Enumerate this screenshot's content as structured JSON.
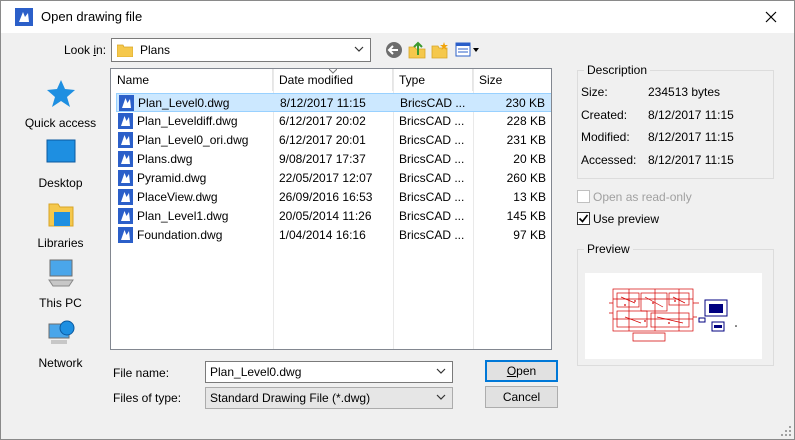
{
  "window": {
    "title": "Open drawing file",
    "close_icon": "close-icon"
  },
  "lookin": {
    "label_pre": "Look ",
    "label_ul": "i",
    "label_post": "n:",
    "value": "Plans",
    "toolbar": [
      "back-arrow-icon",
      "up-folder-icon",
      "new-folder-icon",
      "view-menu-icon"
    ]
  },
  "places": [
    {
      "label": "Quick access",
      "icon": "star-icon"
    },
    {
      "label": "Desktop",
      "icon": "desktop-icon"
    },
    {
      "label": "Libraries",
      "icon": "libraries-icon"
    },
    {
      "label": "This PC",
      "icon": "computer-icon"
    },
    {
      "label": "Network",
      "icon": "network-icon"
    }
  ],
  "columns": [
    "Name",
    "Date modified",
    "Type",
    "Size"
  ],
  "files": [
    {
      "name": "Plan_Level0.dwg",
      "date": "8/12/2017 11:15",
      "type": "BricsCAD ...",
      "size": "230 KB",
      "selected": true
    },
    {
      "name": "Plan_Leveldiff.dwg",
      "date": "6/12/2017 20:02",
      "type": "BricsCAD ...",
      "size": "228 KB"
    },
    {
      "name": "Plan_Level0_ori.dwg",
      "date": "6/12/2017 20:01",
      "type": "BricsCAD ...",
      "size": "231 KB"
    },
    {
      "name": "Plans.dwg",
      "date": "9/08/2017 17:37",
      "type": "BricsCAD ...",
      "size": "20 KB"
    },
    {
      "name": "Pyramid.dwg",
      "date": "22/05/2017 12:07",
      "type": "BricsCAD ...",
      "size": "260 KB"
    },
    {
      "name": "PlaceView.dwg",
      "date": "26/09/2016 16:53",
      "type": "BricsCAD ...",
      "size": "13 KB"
    },
    {
      "name": "Plan_Level1.dwg",
      "date": "20/05/2014 11:26",
      "type": "BricsCAD ...",
      "size": "145 KB"
    },
    {
      "name": "Foundation.dwg",
      "date": "1/04/2014 16:16",
      "type": "BricsCAD ...",
      "size": "97 KB"
    }
  ],
  "description": {
    "title": "Description",
    "size_label": "Size:",
    "size_value": "234513 bytes",
    "created_label": "Created:",
    "created_value": "8/12/2017 11:15",
    "modified_label": "Modified:",
    "modified_value": "8/12/2017 11:15",
    "accessed_label": "Accessed:",
    "accessed_value": "8/12/2017 11:15"
  },
  "options": {
    "readonly_label": "Open as read-only",
    "readonly_checked": false,
    "readonly_enabled": false,
    "preview_label": "Use preview",
    "preview_checked": true
  },
  "preview": {
    "title": "Preview"
  },
  "form": {
    "filename_label": "File name:",
    "filename_value": "Plan_Level0.dwg",
    "filetype_label": "Files of type:",
    "filetype_value": "Standard Drawing File (*.dwg)"
  },
  "buttons": {
    "open_ul": "O",
    "open_rest": "pen",
    "cancel": "Cancel"
  },
  "colors": {
    "accent": "#0078d7",
    "selection": "#cce8ff",
    "bricscad_blue": "#2b5fc9"
  }
}
